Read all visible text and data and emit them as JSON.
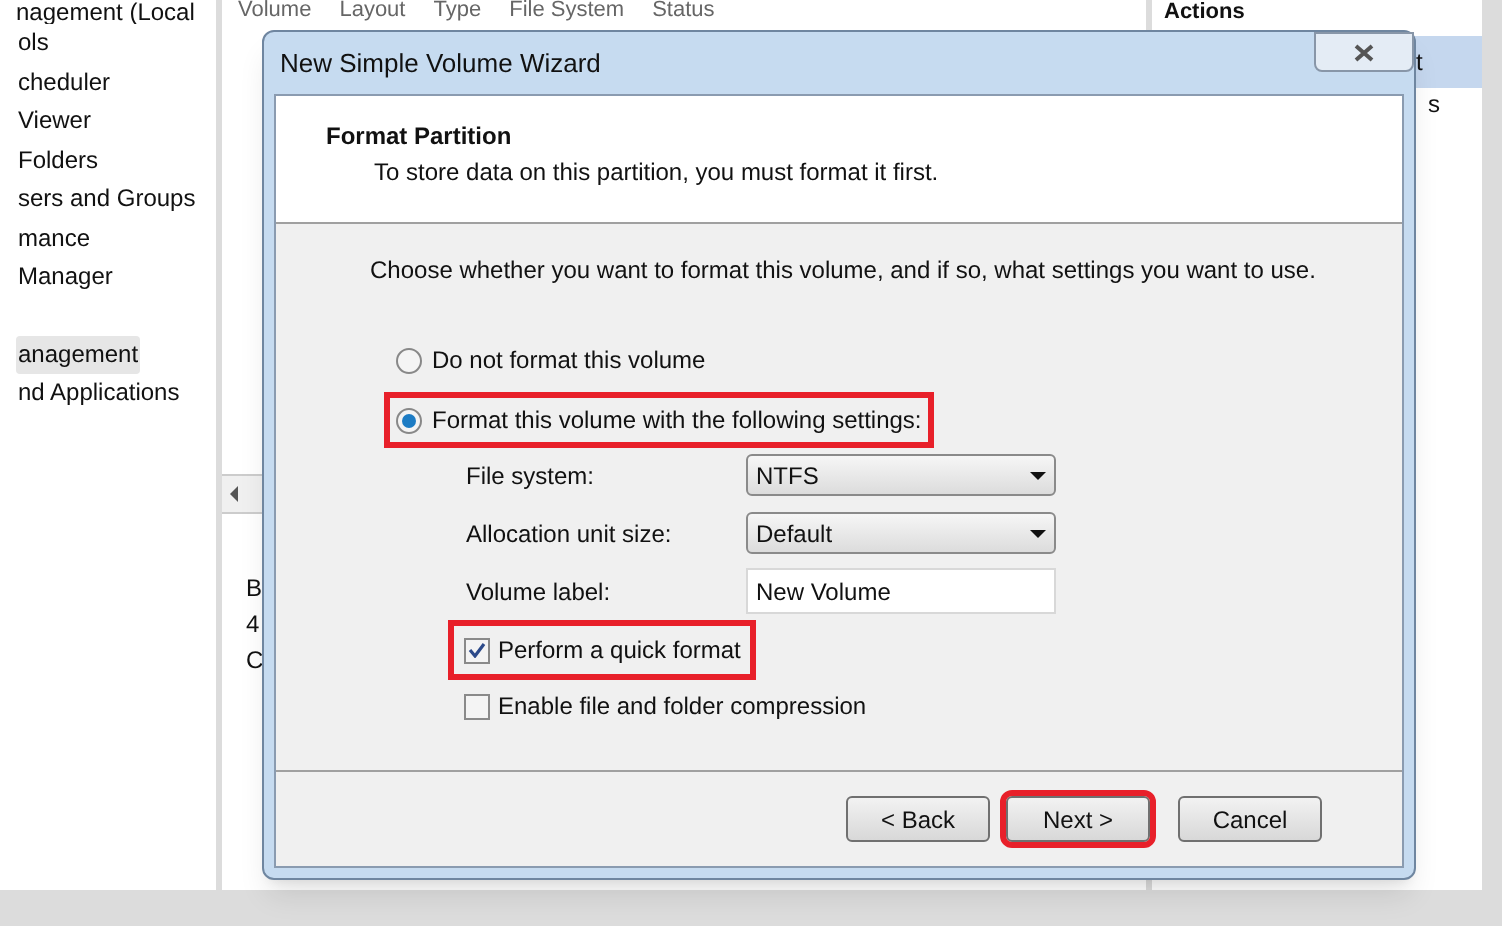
{
  "background": {
    "tree_top": "nagement (Local",
    "tree": [
      {
        "label": "ols",
        "selected": false
      },
      {
        "label": "cheduler",
        "selected": false
      },
      {
        "label": "Viewer",
        "selected": false
      },
      {
        "label": "Folders",
        "selected": false
      },
      {
        "label": "sers and Groups",
        "selected": false
      },
      {
        "label": "mance",
        "selected": false
      },
      {
        "label": "Manager",
        "selected": false
      },
      {
        "label": "anagement",
        "selected": true
      },
      {
        "label": "nd Applications",
        "selected": false
      }
    ],
    "columns": [
      "Volume",
      "Layout",
      "Type",
      "File System",
      "Status"
    ],
    "disk_lines": [
      "B",
      "4",
      "C"
    ],
    "actions_title": "Actions",
    "actions": [
      "t",
      "s"
    ]
  },
  "dialog": {
    "title": "New Simple Volume Wizard",
    "heading": "Format Partition",
    "subtitle": "To store data on this partition, you must format it first.",
    "instruction": "Choose whether you want to format this volume, and if so, what settings you want to use.",
    "options": [
      {
        "label": "Do not format this volume",
        "selected": false,
        "highlighted": false
      },
      {
        "label": "Format this volume with the following settings:",
        "selected": true,
        "highlighted": true
      }
    ],
    "fields": [
      {
        "kind": "dropdown",
        "label": "File system:",
        "value": "NTFS"
      },
      {
        "kind": "dropdown",
        "label": "Allocation unit size:",
        "value": "Default"
      },
      {
        "kind": "text",
        "label": "Volume label:",
        "value": "New Volume"
      }
    ],
    "checkboxes": [
      {
        "label": "Perform a quick format",
        "checked": true,
        "highlighted": true
      },
      {
        "label": "Enable file and folder compression",
        "checked": false,
        "highlighted": false
      }
    ],
    "buttons": [
      {
        "label": "< Back",
        "highlighted": false
      },
      {
        "label": "Next >",
        "highlighted": true
      },
      {
        "label": "Cancel",
        "highlighted": false
      }
    ]
  }
}
